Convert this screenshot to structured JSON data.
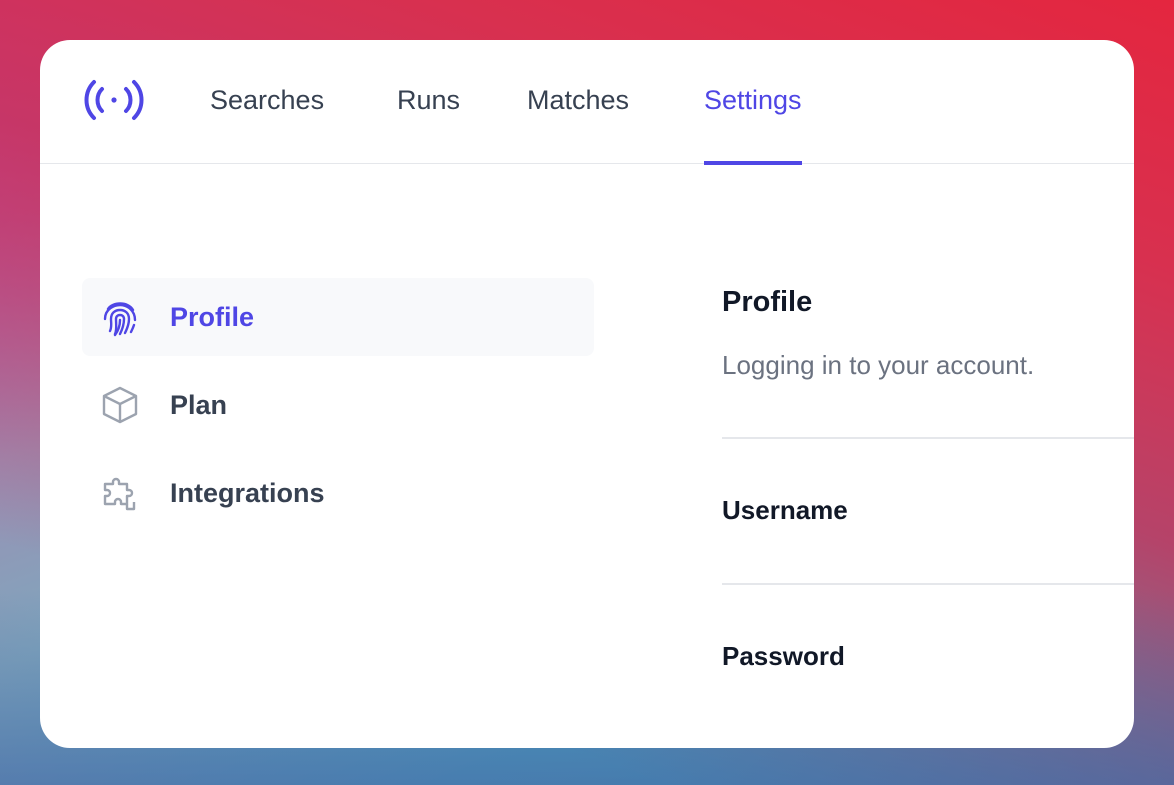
{
  "nav": {
    "tabs": [
      {
        "label": "Searches",
        "active": false
      },
      {
        "label": "Runs",
        "active": false
      },
      {
        "label": "Matches",
        "active": false
      },
      {
        "label": "Settings",
        "active": true
      }
    ],
    "logo_icon": "broadcast-signal-icon"
  },
  "sidebar": {
    "items": [
      {
        "label": "Profile",
        "icon": "fingerprint-icon",
        "active": true
      },
      {
        "label": "Plan",
        "icon": "cube-icon",
        "active": false
      },
      {
        "label": "Integrations",
        "icon": "puzzle-piece-icon",
        "active": false
      }
    ]
  },
  "main": {
    "title": "Profile",
    "description": "Logging in to your account.",
    "fields": [
      {
        "label": "Username"
      },
      {
        "label": "Password"
      }
    ]
  },
  "colors": {
    "accent": "#4f46e5",
    "text": "#374151",
    "muted": "#6b7280",
    "heading": "#111827"
  }
}
